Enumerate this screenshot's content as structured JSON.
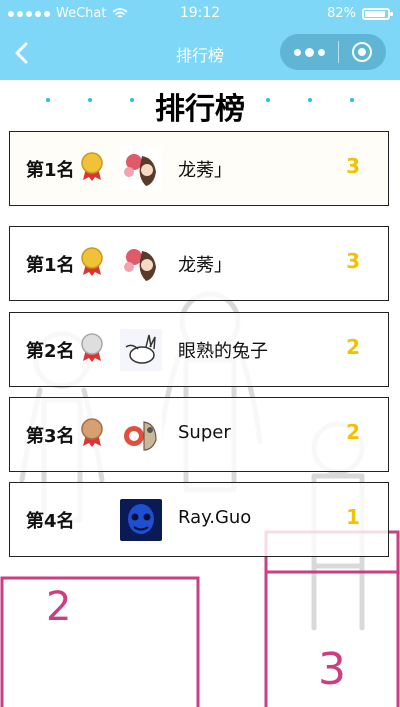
{
  "status": {
    "carrier": "WeChat",
    "time": "19:12",
    "battery": "82%",
    "battery_level": 0.82
  },
  "nav": {
    "title": "排行榜"
  },
  "heading": "排行榜",
  "colors": {
    "nav_bg": "#7fd7f7",
    "score": "#f2c200",
    "dots": "#22c4d6",
    "podium": "#cc3d82"
  },
  "rows": [
    {
      "rank": "第1名",
      "medal": "gold-medal-icon",
      "avatar": "avatar-flowers",
      "name": "龙莠」",
      "score": "3"
    },
    {
      "rank": "第1名",
      "medal": "gold-medal-icon",
      "avatar": "avatar-flowers",
      "name": "龙莠」",
      "score": "3"
    },
    {
      "rank": "第2名",
      "medal": "silver-medal-icon",
      "avatar": "avatar-rabbit",
      "name": "眼熟的兔子",
      "score": "2"
    },
    {
      "rank": "第3名",
      "medal": "bronze-medal-icon",
      "avatar": "avatar-cartoon",
      "name": "Super",
      "score": "2"
    },
    {
      "rank": "第4名",
      "medal": "",
      "avatar": "avatar-blue-face",
      "name": "Ray.Guo",
      "score": "1"
    }
  ],
  "podium": {
    "second": "2",
    "third": "3"
  }
}
